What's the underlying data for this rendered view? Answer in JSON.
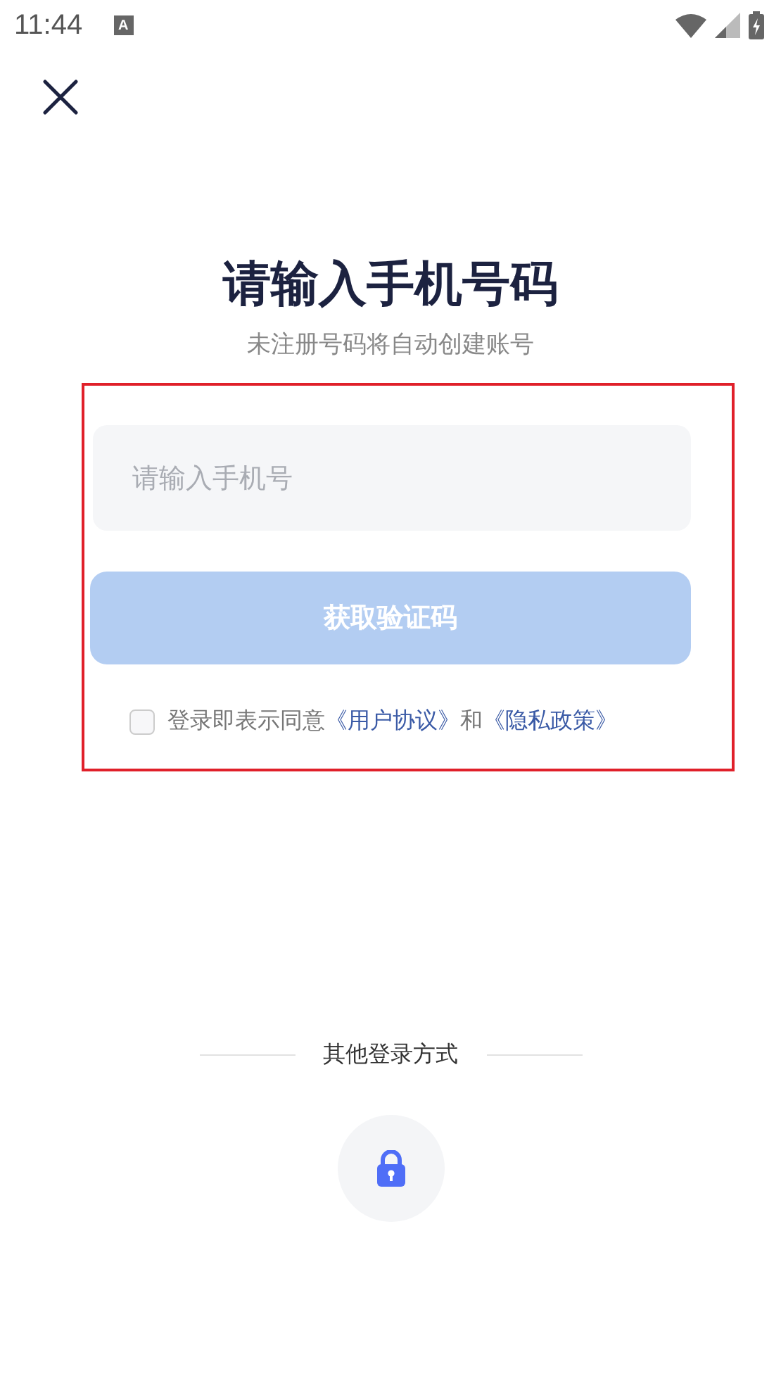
{
  "status_bar": {
    "time": "11:44",
    "notification_icon": "A"
  },
  "title": "请输入手机号码",
  "subtitle": "未注册号码将自动创建账号",
  "phone_field": {
    "placeholder": "请输入手机号"
  },
  "get_code_button": {
    "label": "获取验证码",
    "disabled": true
  },
  "agreement": {
    "checked": false,
    "text": "登录即表示同意",
    "link_1": "《用户协议》",
    "joiner": "和",
    "link_2": "《隐私政策》"
  },
  "other_login": {
    "label": "其他登录方式"
  }
}
